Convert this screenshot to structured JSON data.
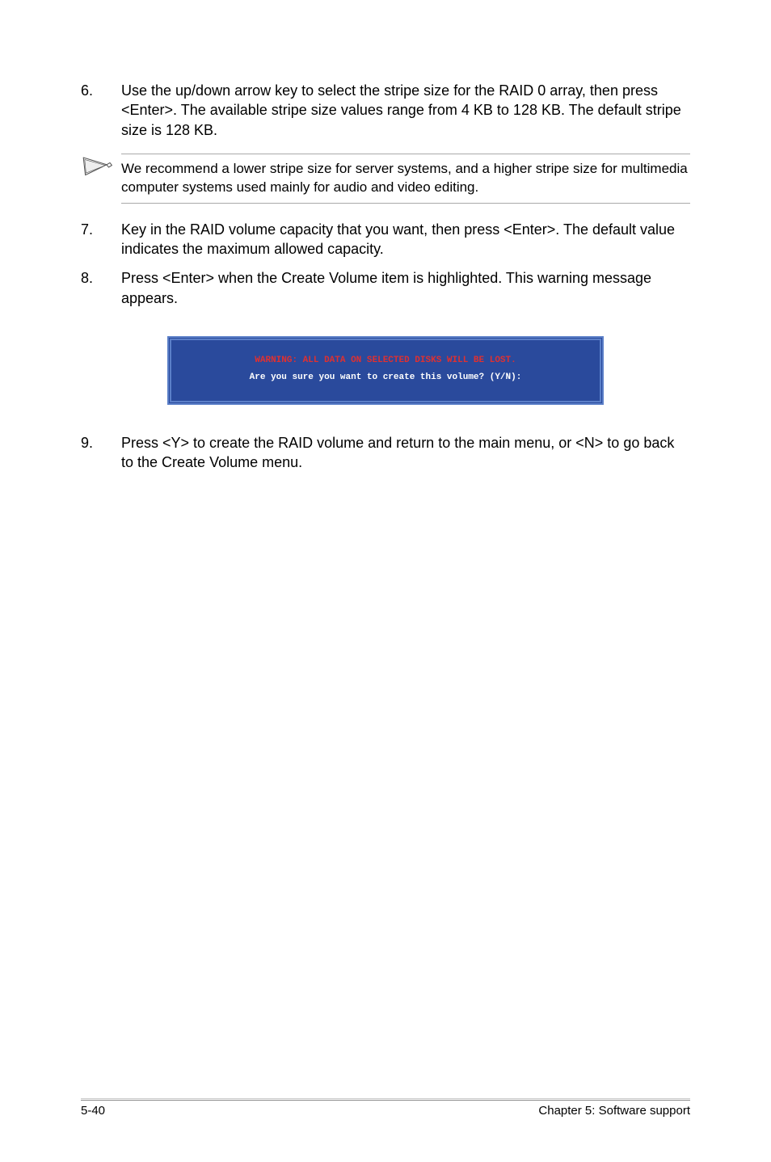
{
  "items": {
    "6": {
      "num": "6.",
      "text": "Use the up/down arrow key to select the stripe size for the RAID 0 array, then press <Enter>. The available stripe size values range from 4 KB to 128 KB. The default stripe size is 128 KB."
    },
    "7": {
      "num": "7.",
      "text": "Key in the RAID volume capacity that you want, then press <Enter>. The default value indicates the maximum allowed capacity."
    },
    "8": {
      "num": "8.",
      "text": "Press <Enter> when the Create Volume item is highlighted. This warning message appears."
    },
    "9": {
      "num": "9.",
      "text": "Press <Y> to create the RAID volume and return to the main menu, or <N> to go back to the Create Volume menu."
    }
  },
  "note": "We recommend a lower stripe size for server systems, and a higher stripe size for multimedia computer systems used mainly for audio and video editing.",
  "terminal": {
    "warning": "WARNING: ALL DATA ON SELECTED DISKS WILL BE LOST.",
    "prompt": "Are you sure you want to create this volume? (Y/N):"
  },
  "footer": {
    "left": "5-40",
    "right": "Chapter 5: Software support"
  }
}
